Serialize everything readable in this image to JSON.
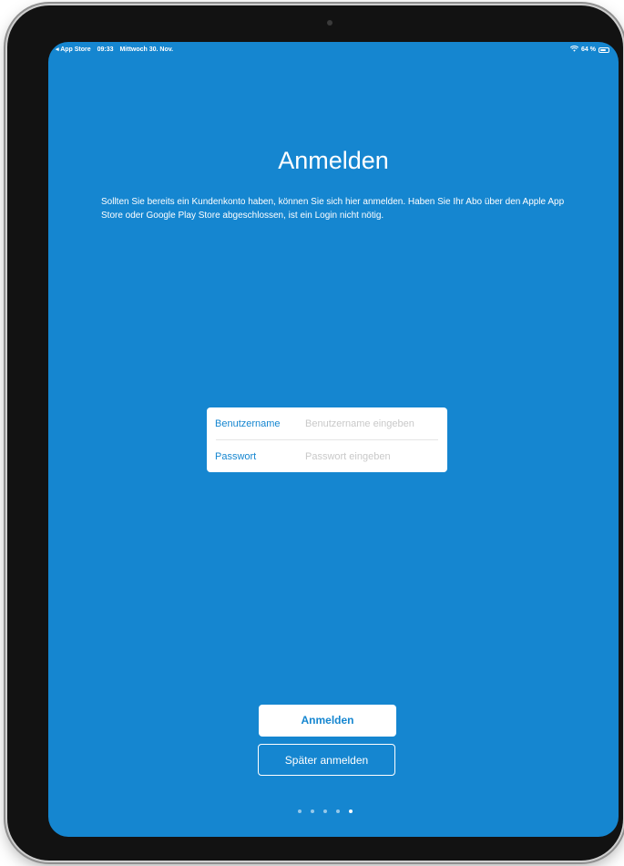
{
  "status_bar": {
    "back_app": "◂ App Store",
    "time": "09:33",
    "date": "Mittwoch 30. Nov.",
    "battery": "64 %"
  },
  "page": {
    "title": "Anmelden",
    "subtitle": "Sollten Sie bereits ein Kundenkonto haben, können Sie sich hier anmelden. Haben Sie Ihr Abo über den Apple App Store oder Google Play Store abgeschlossen, ist ein Login nicht nötig."
  },
  "form": {
    "username_label": "Benutzername",
    "username_placeholder": "Benutzername eingeben",
    "password_label": "Passwort",
    "password_placeholder": "Passwort eingeben"
  },
  "actions": {
    "login_label": "Anmelden",
    "later_label": "Später anmelden"
  },
  "pager": {
    "count": 5,
    "active_index": 4
  },
  "colors": {
    "screen_background": "#1586d0",
    "accent": "#1586d0"
  }
}
